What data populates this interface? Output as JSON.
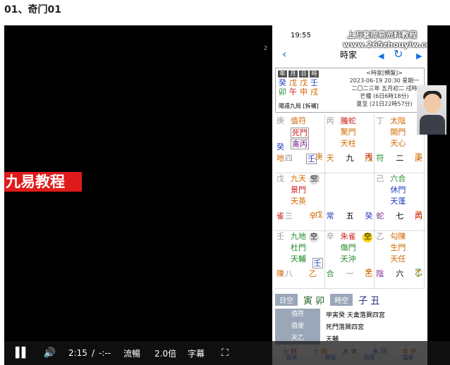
{
  "page_title": "01、奇门01",
  "banner": "九易教程",
  "watermark": [
    "上万套周易资料教程",
    "www.265zhouyiw.com"
  ],
  "watermark_side": "2",
  "phone": {
    "status_time": "19:55",
    "nav": {
      "back": "‹",
      "title": "時家",
      "prev": "◀",
      "refresh": "↻",
      "next": "▶"
    },
    "pillars": {
      "headers": [
        "年",
        "月",
        "日",
        "時"
      ],
      "stems": [
        "癸",
        "戊",
        "戊",
        "壬"
      ],
      "branches": [
        "卯",
        "午",
        "申",
        "戌"
      ]
    },
    "ju": "陽遁九局 [拆補]",
    "meta": [
      "<時家[轉盤]>",
      "2023-06-19 20:30 星期一",
      "二〇二三年 五月初二 戌時",
      "芒種 (6日6時18分)",
      "夏至 (21日22時57分)"
    ],
    "palaces": [
      {
        "tl": "庚",
        "god": "值符",
        "door": "死門",
        "star": "禽丙",
        "ml": "癸",
        "mr": "庚",
        "bl": "地",
        "bn": "四",
        "bc": "壬",
        "br": "",
        "hs": "",
        "tr": ""
      },
      {
        "tl": "丙",
        "god": "螣蛇",
        "door": "驚門",
        "star": "天柱",
        "ml": "",
        "mr": "丙",
        "bl": "天",
        "bn": "",
        "bc": "九",
        "br": "戊",
        "hs": "",
        "tr": ""
      },
      {
        "tl": "丁",
        "god": "太陰",
        "door": "開門",
        "star": "天心",
        "ml": "",
        "mr": "丁",
        "bl": "符",
        "bn": "",
        "bc": "二",
        "br": "庚",
        "hs": "",
        "tr": ""
      },
      {
        "tl": "戊",
        "god": "九天",
        "door": "景門",
        "star": "天英",
        "ml": "",
        "mr": "戊",
        "bl": "雀",
        "bn": "三",
        "bc": "辛",
        "br": "",
        "hs": "空",
        "tr": "癸"
      },
      {
        "tl": "",
        "god": "",
        "door": "",
        "star": "",
        "ml": "",
        "mr": "",
        "bl": "常",
        "bn": "",
        "bc": "五",
        "br": "癸",
        "hs": "",
        "tr": ""
      },
      {
        "tl": "己",
        "god": "六合",
        "door": "休門",
        "star": "天蓬",
        "ml": "",
        "mr": "己",
        "bl": "蛇",
        "bn": "",
        "bc": "七",
        "br": "丙",
        "hs": "",
        "tr": ""
      },
      {
        "tl": "壬",
        "god": "九地",
        "door": "杜門",
        "star": "天輔",
        "ml": "",
        "mr": "",
        "bl": "陳",
        "bn": "八",
        "bc": "乙",
        "br": "壬",
        "hs": "空",
        "tr": ""
      },
      {
        "tl": "辛",
        "god": "朱雀",
        "door": "傷門",
        "star": "天沖",
        "ml": "",
        "mr": "辛",
        "bl": "合",
        "bn": "",
        "bc": "一",
        "br": "乙",
        "hs": "空",
        "tr": ""
      },
      {
        "tl": "乙",
        "god": "勾陳",
        "door": "生門",
        "star": "天任",
        "ml": "",
        "mr": "乙",
        "bl": "陰",
        "bn": "",
        "bc": "六",
        "br": "丁",
        "hs": "",
        "tr": ""
      }
    ],
    "void_row": {
      "day_label": "日空",
      "day_value": "寅 卯",
      "hour_label": "時空",
      "hour_value": "子 丑"
    },
    "duty": [
      {
        "k": "值符",
        "v": "甲寅癸  天禽落巽四宮"
      },
      {
        "k": "值使",
        "v": "死門落巽四宮"
      },
      {
        "k": "天乙",
        "v": "天輔"
      }
    ],
    "phases": [
      "火 旺",
      "土 相",
      "木 休",
      "水 囚",
      "金 死"
    ],
    "tabs": [
      "首頁",
      "轉盤",
      "飛盤",
      "檔案"
    ]
  },
  "controls": {
    "time": "2:15",
    "separator": "/",
    "duration": "-:--",
    "quality": "流暢",
    "speed": "2.0倍",
    "subtitle": "字幕"
  },
  "colors": {
    "banner_bg": "#e01a1a",
    "player_bg": "#000000",
    "accent_blue": "#1a6fe0"
  }
}
